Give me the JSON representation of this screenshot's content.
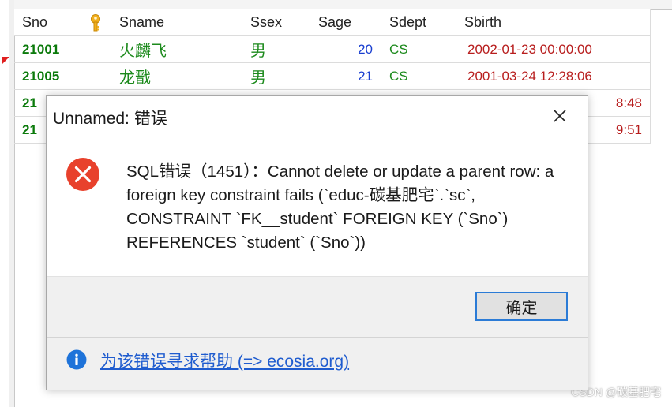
{
  "grid": {
    "headers": {
      "sno": "Sno",
      "sname": "Sname",
      "ssex": "Ssex",
      "sage": "Sage",
      "sdept": "Sdept",
      "sbirth": "Sbirth"
    },
    "rows": [
      {
        "sno": "21001",
        "sname": "火麟飞",
        "ssex": "男",
        "sage": "20",
        "sdept": "CS",
        "sbirth": "2002-01-23 00:00:00"
      },
      {
        "sno": "21005",
        "sname": "龙戬",
        "ssex": "男",
        "sage": "21",
        "sdept": "CS",
        "sbirth": "2001-03-24 12:28:06"
      },
      {
        "sno": "21",
        "sname": "",
        "ssex": "",
        "sage": "",
        "sdept": "",
        "sbirth": "8:48"
      },
      {
        "sno": "21",
        "sname": "",
        "ssex": "",
        "sage": "",
        "sdept": "",
        "sbirth": "9:51"
      }
    ],
    "primary_key_icon": "key-icon",
    "current_row_marker_color": "#e02020"
  },
  "dialog": {
    "title": "Unnamed: 错误",
    "message": "SQL错误（1451）：Cannot delete or update a parent row: a foreign key constraint fails (`educ-碳基肥宅`.`sc`, CONSTRAINT `FK__student` FOREIGN KEY (`Sno`) REFERENCES `student` (`Sno`))",
    "ok_label": "确定",
    "help_link": "为该错误寻求帮助 (=> ecosia.org)",
    "icons": {
      "error": "error-icon",
      "close": "close-icon",
      "info": "info-icon"
    },
    "colors": {
      "error": "#e8412c",
      "info": "#1e73d9",
      "link": "#1f5ccf",
      "focus": "#2b7bd6"
    }
  },
  "watermark": "CSDN @碳基肥宅"
}
